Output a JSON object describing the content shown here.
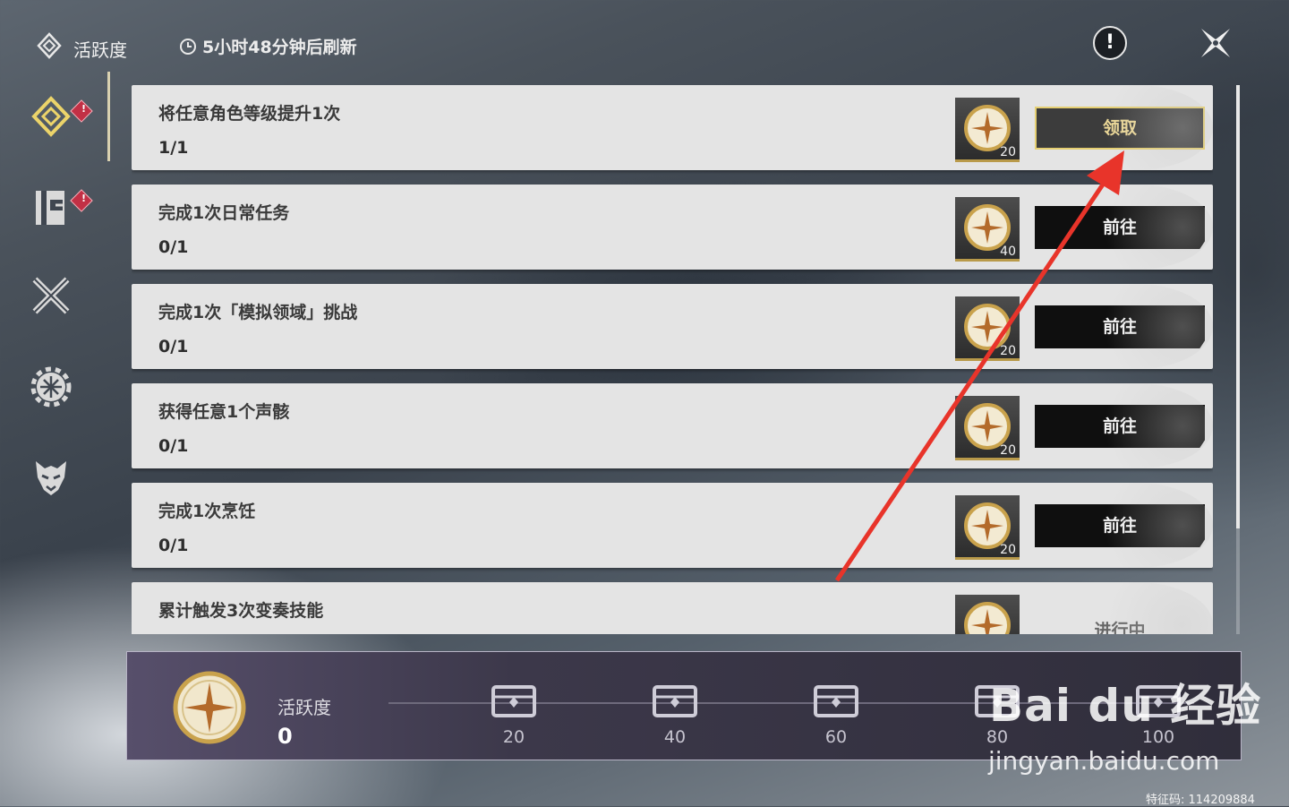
{
  "header": {
    "title": "活跃度",
    "refresh_text": "5小时48分钟后刷新",
    "info_label": "!"
  },
  "sidenav": {
    "items": [
      {
        "icon": "activity-diamond-icon",
        "badge": "!",
        "active": true
      },
      {
        "icon": "calendar-book-icon",
        "badge": "!"
      },
      {
        "icon": "crossed-swords-icon"
      },
      {
        "icon": "gear-emblem-icon"
      },
      {
        "icon": "demon-mask-icon"
      }
    ]
  },
  "tasks": [
    {
      "name": "将任意角色等级提升1次",
      "progress": "1/1",
      "reward_qty": "20",
      "button": "领取",
      "state": "claim"
    },
    {
      "name": "完成1次日常任务",
      "progress": "0/1",
      "reward_qty": "40",
      "button": "前往",
      "state": "go"
    },
    {
      "name": "完成1次「模拟领域」挑战",
      "progress": "0/1",
      "reward_qty": "20",
      "button": "前往",
      "state": "go"
    },
    {
      "name": "获得任意1个声骸",
      "progress": "0/1",
      "reward_qty": "20",
      "button": "前往",
      "state": "go"
    },
    {
      "name": "完成1次烹饪",
      "progress": "0/1",
      "reward_qty": "20",
      "button": "前往",
      "state": "go"
    },
    {
      "name": "累计触发3次变奏技能",
      "progress": "",
      "reward_qty": "",
      "button": "进行中",
      "state": "pending"
    }
  ],
  "bottom": {
    "label": "活跃度",
    "value": "0",
    "milestones": [
      "20",
      "40",
      "60",
      "80",
      "100"
    ]
  },
  "watermark": {
    "brand": "Bai du 经验",
    "url": "jingyan.baidu.com",
    "code": "特征码: 114209884"
  },
  "colors": {
    "accent_gold": "#e5cf72",
    "badge_red": "#c23045",
    "annotation_arrow": "#e8342a"
  }
}
